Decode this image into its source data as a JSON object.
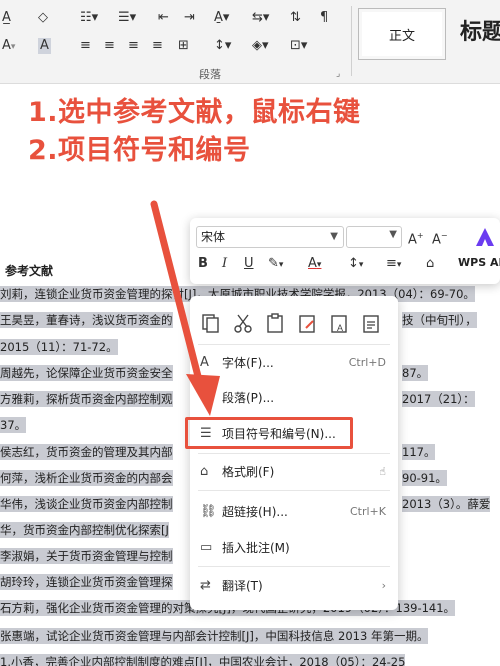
{
  "ribbon": {
    "style_normal": "正文",
    "style_heading": "标题",
    "group_paragraph": "段落"
  },
  "overlay": {
    "line1": "1.选中参考文献，鼠标右键",
    "line2": "2.项目符号和编号"
  },
  "document": {
    "heading": "参考文献",
    "lines": [
      "刘莉，连锁企业货币资金管理的探讨[J]，太原城市职业技术学院学报，2013（04）：69-70。",
      "王昊昱，董春诗，浅议货币资金的",
      "2015（11）：71-72。",
      "周越先，论保障企业货币资金安全",
      "方雅莉，探析货币资金内部控制观",
      "37。",
      "侯志红，货币资金的管理及其内部",
      "何萍，浅析企业货币资金的内部会",
      "华伟，浅谈企业货币资金内部控制",
      "华，货币资金内部控制优化探索[J",
      "李淑娟，关于货币资金管理与控制",
      "胡玲玲，连锁企业货币资金管理探",
      "石方莉，强化企业货币资金管理的对策探究[J]，现代国企研究，2019（02）：139-141。",
      "张惠端，试论企业货币资金管理与内部会计控制[J]，中国科技信息 2013 年第一期。",
      "1.小香，完善企业内部控制制度的难点[J]，中国农业会计，2018（05）：24-25"
    ],
    "right_fragments": {
      "l2": "技（中旬刊），",
      "l4": "87。",
      "l5": "2017（21）：",
      "l7": "117。",
      "l8": "90-91。",
      "l9": "2013（3）。薛爱"
    }
  },
  "mini_toolbar": {
    "font_name": "宋体",
    "wps_ai_label": "WPS AI"
  },
  "context_menu": {
    "items": [
      {
        "label": "字体(F)...",
        "shortcut": "Ctrl+D"
      },
      {
        "label": "段落(P)...",
        "shortcut": ""
      },
      {
        "label": "项目符号和编号(N)...",
        "shortcut": ""
      },
      {
        "label": "格式刷(F)",
        "shortcut": ""
      },
      {
        "label": "超链接(H)...",
        "shortcut": "Ctrl+K"
      },
      {
        "label": "插入批注(M)",
        "shortcut": ""
      },
      {
        "label": "翻译(T)",
        "shortcut": ""
      }
    ]
  },
  "colors": {
    "annotation_red": "#e8513d",
    "selection_gray": "#c9cbd2",
    "wps_ai_purple": "#6b3cf0"
  }
}
